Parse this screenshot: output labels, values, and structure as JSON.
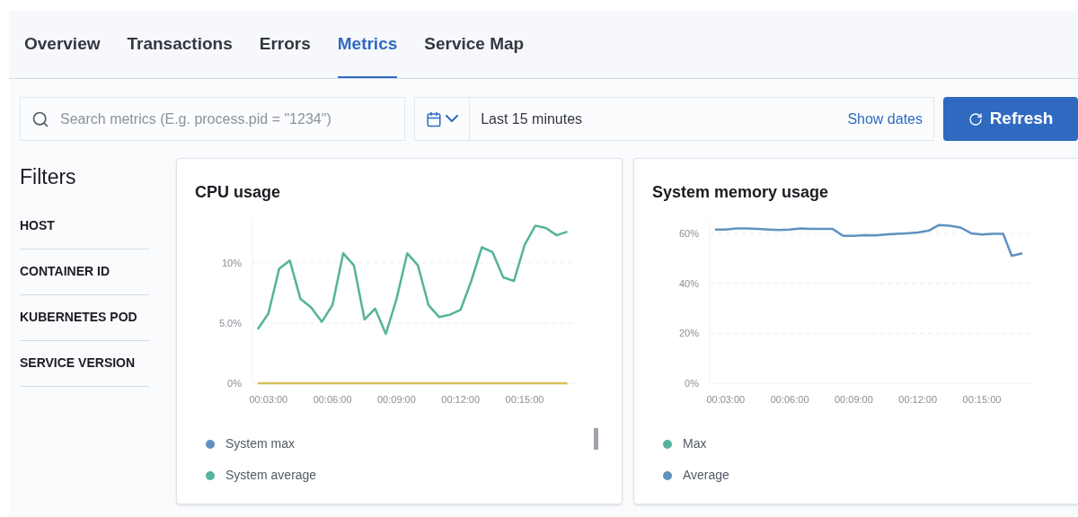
{
  "tabs": [
    {
      "label": "Overview",
      "selected": false
    },
    {
      "label": "Transactions",
      "selected": false
    },
    {
      "label": "Errors",
      "selected": false
    },
    {
      "label": "Metrics",
      "selected": true
    },
    {
      "label": "Service Map",
      "selected": false
    }
  ],
  "search": {
    "placeholder": "Search metrics (E.g. process.pid = \"1234\")"
  },
  "date_picker": {
    "value": "Last 15 minutes",
    "show_dates": "Show dates"
  },
  "refresh_button": {
    "label": "Refresh"
  },
  "filters": {
    "title": "Filters",
    "items": [
      "HOST",
      "CONTAINER ID",
      "KUBERNETES POD",
      "SERVICE VERSION"
    ]
  },
  "charts": [
    {
      "title": "CPU usage",
      "legend": [
        {
          "name": "System max",
          "color": "#6092c0"
        },
        {
          "name": "System average",
          "color": "#54b399"
        }
      ],
      "chart_data": {
        "type": "line",
        "grid": true,
        "xlim": [
          2.25,
          17.4
        ],
        "ylim": [
          0,
          13.5
        ],
        "xticks": [
          {
            "value": 3,
            "label": "00:03:00"
          },
          {
            "value": 6,
            "label": "00:06:00"
          },
          {
            "value": 9,
            "label": "00:09:00"
          },
          {
            "value": 12,
            "label": "00:12:00"
          },
          {
            "value": 15,
            "label": "00:15:00"
          }
        ],
        "yticks": [
          {
            "value": 0,
            "label": "0%"
          },
          {
            "value": 5,
            "label": "5.0%"
          },
          {
            "value": 10,
            "label": "10%"
          }
        ],
        "x": [
          2.5,
          3,
          3.5,
          4,
          4.5,
          5,
          5.5,
          6,
          6.5,
          7,
          7.5,
          8,
          8.5,
          9,
          9.5,
          10,
          10.5,
          11,
          11.5,
          12,
          12.5,
          13,
          13.5,
          14,
          14.5,
          15,
          15.5,
          16,
          16.5,
          17
        ],
        "series": [
          {
            "color": "#54b399",
            "values": [
              4.5,
              5.8,
              9.5,
              10.2,
              7.0,
              6.3,
              5.1,
              6.5,
              10.8,
              9.8,
              5.3,
              6.2,
              4.1,
              7.0,
              10.8,
              9.8,
              6.5,
              5.5,
              5.7,
              6.1,
              8.5,
              11.3,
              10.9,
              8.8,
              8.5,
              11.5,
              13.1,
              12.9,
              12.3,
              12.6
            ]
          },
          {
            "color": "#d6bf57",
            "values": [
              0,
              0,
              0,
              0,
              0,
              0,
              0,
              0,
              0,
              0,
              0,
              0,
              0,
              0,
              0,
              0,
              0,
              0,
              0,
              0,
              0,
              0,
              0,
              0,
              0,
              0,
              0,
              0,
              0,
              0
            ]
          }
        ]
      }
    },
    {
      "title": "System memory usage",
      "legend": [
        {
          "name": "Max",
          "color": "#54b399"
        },
        {
          "name": "Average",
          "color": "#6092c0"
        }
      ],
      "chart_data": {
        "type": "line",
        "grid": true,
        "xlim": [
          2.25,
          17.4
        ],
        "ylim": [
          0,
          65
        ],
        "xticks": [
          {
            "value": 3,
            "label": "00:03:00"
          },
          {
            "value": 6,
            "label": "00:06:00"
          },
          {
            "value": 9,
            "label": "00:09:00"
          },
          {
            "value": 12,
            "label": "00:12:00"
          },
          {
            "value": 15,
            "label": "00:15:00"
          }
        ],
        "yticks": [
          {
            "value": 0,
            "label": "0%"
          },
          {
            "value": 20,
            "label": "20%"
          },
          {
            "value": 40,
            "label": "40%"
          },
          {
            "value": 60,
            "label": "60%"
          }
        ],
        "x": [
          2.5,
          3,
          3.5,
          4,
          4.5,
          5,
          5.5,
          6,
          6.5,
          7,
          7.5,
          8,
          8.5,
          9,
          9.5,
          10,
          10.5,
          11,
          11.5,
          12,
          12.5,
          13,
          13.5,
          14,
          14.5,
          15,
          15.5,
          16,
          16.4,
          16.9
        ],
        "series": [
          {
            "color": "#6092c0",
            "values": [
              61.5,
              61.5,
              62,
              62,
              61.8,
              61.5,
              61.3,
              61.5,
              62,
              61.8,
              61.8,
              61.8,
              59,
              59,
              59.3,
              59.2,
              59.5,
              59.8,
              60,
              60.3,
              61,
              63.3,
              63,
              62.3,
              60,
              59.5,
              59.8,
              59.8,
              51,
              52
            ]
          }
        ]
      }
    }
  ]
}
